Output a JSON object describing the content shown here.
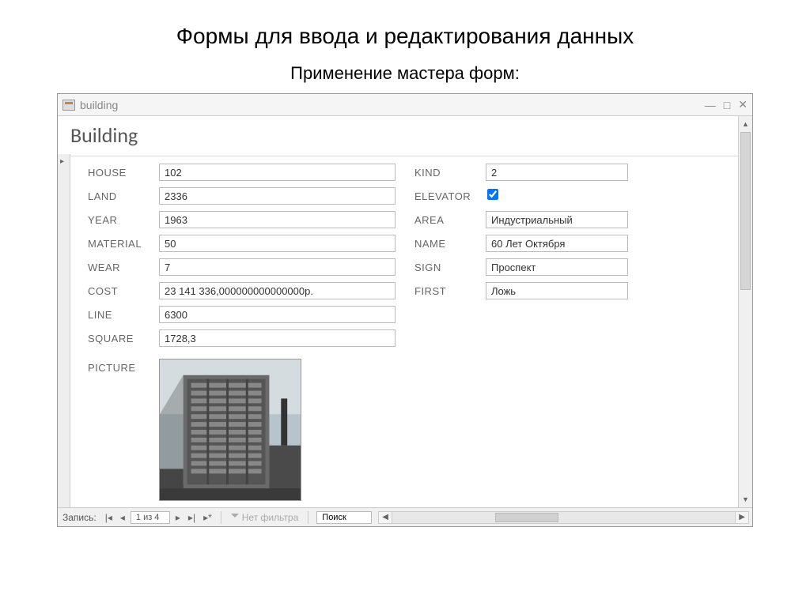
{
  "slide": {
    "title": "Формы для ввода и редактирования данных",
    "subtitle": "Применение мастера форм:"
  },
  "window": {
    "title": "building",
    "form_title": "Building"
  },
  "labels": {
    "house": "HOUSE",
    "land": "LAND",
    "year": "YEAR",
    "material": "MATERIAL",
    "wear": "WEAR",
    "cost": "COST",
    "line": "LINE",
    "square": "SQUARE",
    "picture": "PICTURE",
    "kind": "KIND",
    "elevator": "ELEVATOR",
    "area": "AREA",
    "name": "NAME",
    "sign": "SIGN",
    "first": "FIRST"
  },
  "values": {
    "house": "102",
    "land": "2336",
    "year": "1963",
    "material": "50",
    "wear": "7",
    "cost": "23 141 336,000000000000000р.",
    "line": "6300",
    "square": "1728,3",
    "kind": "2",
    "elevator": true,
    "area": "Индустриальный",
    "name": "60 Лет Октября",
    "sign": "Проспект",
    "first": "Ложь"
  },
  "nav": {
    "record_label": "Запись:",
    "position": "1 из 4",
    "no_filter": "Нет фильтра",
    "search": "Поиск"
  }
}
